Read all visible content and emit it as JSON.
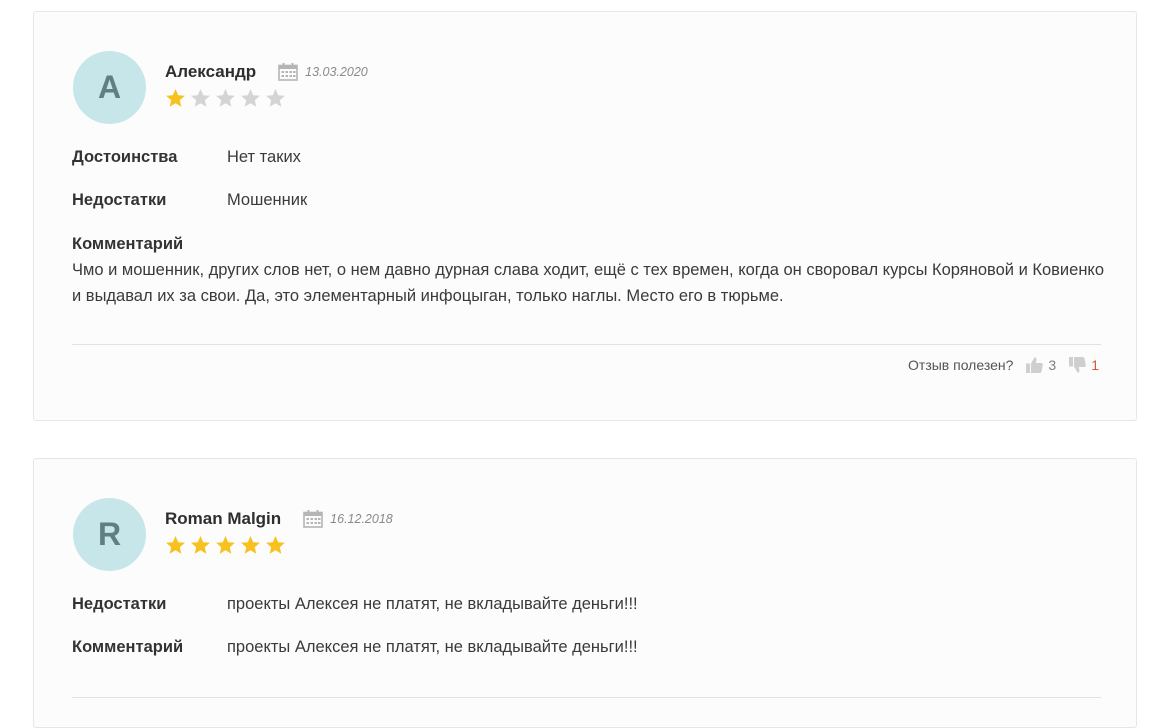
{
  "helpful_prompt": "Отзыв полезен?",
  "colors": {
    "star_filled": "#f7c21f",
    "star_empty": "#d4d4d4",
    "avatar_bg": "#c6e6e9",
    "dislike_count": "#d35a37"
  },
  "reviews": [
    {
      "avatar_letter": "А",
      "author": "Александр",
      "date": "13.03.2020",
      "rating": 1,
      "rating_max": 5,
      "pros_label": "Достоинства",
      "pros": "Нет таких",
      "cons_label": "Недостатки",
      "cons": "Мошенник",
      "comment_label": "Комментарий",
      "comment": "Чмо и мошенник, других слов нет, о нем давно дурная слава ходит, ещё с тех времен, когда он своровал курсы Коряновой и Ковиенко и выдавал их за свои. Да, это элементарный инфоцыган, только наглы. Место его в тюрьме.",
      "likes": "3",
      "dislikes": "1",
      "like_icon": "thumbs-up-icon",
      "dislike_icon": "thumbs-down-icon"
    },
    {
      "avatar_letter": "R",
      "author": "Roman Malgin",
      "date": "16.12.2018",
      "rating": 5,
      "rating_max": 5,
      "cons_label": "Недостатки",
      "cons": "проекты Алексея не платят, не вкладывайте деньги!!!",
      "comment_label": "Комментарий",
      "comment": "проекты Алексея не платят, не вкладывайте деньги!!!"
    }
  ]
}
